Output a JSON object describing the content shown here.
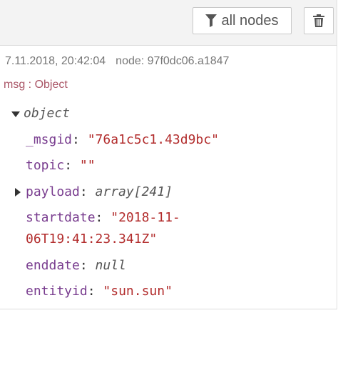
{
  "toolbar": {
    "filter_label": "all nodes",
    "filter_icon": "funnel-icon",
    "clear_icon": "trash-icon"
  },
  "message": {
    "timestamp": "7.11.2018, 20:42:04",
    "node_label": "node: 97f0dc06.a1847",
    "type_label": "msg : Object",
    "root_type": "object",
    "fields": [
      {
        "key": "_msgid",
        "value": "\"76a1c5c1.43d9bc\""
      },
      {
        "key": "topic",
        "value": "\"\""
      },
      {
        "key": "payload",
        "value": "array[241]"
      },
      {
        "key": "startdate",
        "value_line1": "\"2018-11-",
        "value_line2": "06T19:41:23.341Z\""
      },
      {
        "key": "enddate",
        "value": "null"
      },
      {
        "key": "entityid",
        "value": "\"sun.sun\""
      }
    ]
  },
  "colors": {
    "key": "#793d8f",
    "string": "#b22c2c",
    "type": "#555555",
    "msg_type": "#aa5566"
  }
}
